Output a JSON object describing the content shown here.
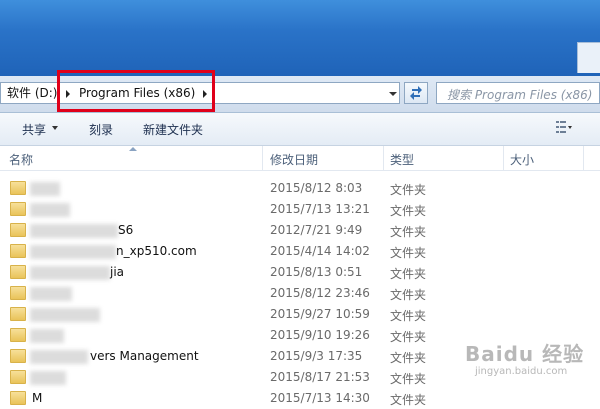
{
  "address": {
    "segments": [
      "软件 (D:)",
      "Program Files (x86)"
    ]
  },
  "search": {
    "placeholder": "搜索 Program Files (x86)"
  },
  "toolbar": {
    "share": "共享",
    "burn": "刻录",
    "new_folder": "新建文件夹"
  },
  "columns": {
    "name": "名称",
    "modified": "修改日期",
    "type": "类型",
    "size": "大小"
  },
  "rows": [
    {
      "name": "",
      "date": "2015/8/12 8:03",
      "type": "文件夹"
    },
    {
      "name": "",
      "date": "2015/7/13 13:21",
      "type": "文件夹"
    },
    {
      "name": "S6",
      "date": "2012/7/21 9:49",
      "type": "文件夹"
    },
    {
      "name": "n_xp510.com",
      "date": "2015/4/14 14:02",
      "type": "文件夹"
    },
    {
      "name": "jia",
      "date": "2015/8/13 0:51",
      "type": "文件夹"
    },
    {
      "name": "",
      "date": "2015/8/12 23:46",
      "type": "文件夹"
    },
    {
      "name": "",
      "date": "2015/9/27 10:59",
      "type": "文件夹"
    },
    {
      "name": "",
      "date": "2015/9/10 19:26",
      "type": "文件夹"
    },
    {
      "name": "vers Management",
      "date": "2015/9/3 17:35",
      "type": "文件夹"
    },
    {
      "name": "",
      "date": "2015/8/17 21:53",
      "type": "文件夹"
    },
    {
      "name": "M",
      "date": "2015/7/13 14:30",
      "type": "文件夹"
    }
  ],
  "watermark": {
    "logo": "Baidu 经验",
    "url": "jingyan.baidu.com"
  }
}
